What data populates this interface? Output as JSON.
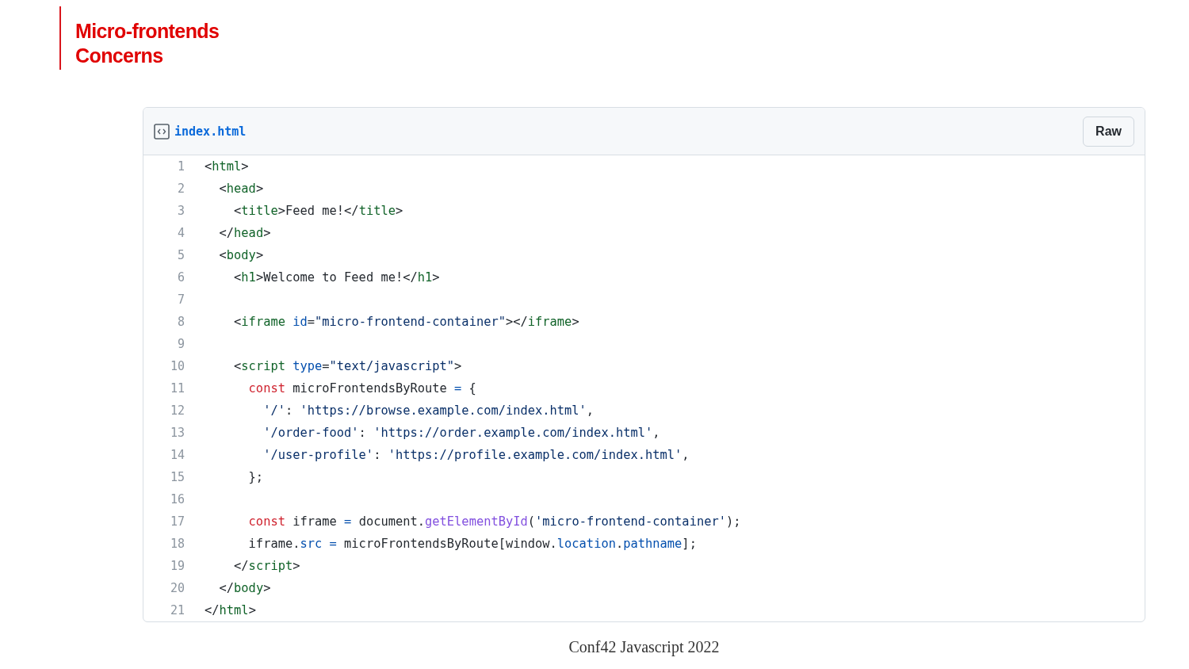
{
  "slide_title": [
    "Micro-frontends",
    "Concerns"
  ],
  "file": {
    "name": "index.html",
    "button": "Raw"
  },
  "lines": [
    {
      "number": "1",
      "tokens": [
        {
          "kind": "plain",
          "text": "<"
        },
        {
          "kind": "tag",
          "text": "html"
        },
        {
          "kind": "plain",
          "text": ">"
        }
      ]
    },
    {
      "number": "2",
      "tokens": [
        {
          "kind": "plain",
          "text": "  <"
        },
        {
          "kind": "tag",
          "text": "head"
        },
        {
          "kind": "plain",
          "text": ">"
        }
      ]
    },
    {
      "number": "3",
      "tokens": [
        {
          "kind": "plain",
          "text": "    <"
        },
        {
          "kind": "tag",
          "text": "title"
        },
        {
          "kind": "plain",
          "text": ">Feed me!</"
        },
        {
          "kind": "tag",
          "text": "title"
        },
        {
          "kind": "plain",
          "text": ">"
        }
      ]
    },
    {
      "number": "4",
      "tokens": [
        {
          "kind": "plain",
          "text": "  </"
        },
        {
          "kind": "tag",
          "text": "head"
        },
        {
          "kind": "plain",
          "text": ">"
        }
      ]
    },
    {
      "number": "5",
      "tokens": [
        {
          "kind": "plain",
          "text": "  <"
        },
        {
          "kind": "tag",
          "text": "body"
        },
        {
          "kind": "plain",
          "text": ">"
        }
      ]
    },
    {
      "number": "6",
      "tokens": [
        {
          "kind": "plain",
          "text": "    <"
        },
        {
          "kind": "tag",
          "text": "h1"
        },
        {
          "kind": "plain",
          "text": ">Welcome to Feed me!</"
        },
        {
          "kind": "tag",
          "text": "h1"
        },
        {
          "kind": "plain",
          "text": ">"
        }
      ]
    },
    {
      "number": "7"
    },
    {
      "number": "8",
      "tokens": [
        {
          "kind": "plain",
          "text": "    <"
        },
        {
          "kind": "tag",
          "text": "iframe"
        },
        {
          "kind": "attr",
          "text": " id"
        },
        {
          "kind": "plain",
          "text": "="
        },
        {
          "kind": "string",
          "text": "\"micro-frontend-container\""
        },
        {
          "kind": "plain",
          "text": "></"
        },
        {
          "kind": "tag",
          "text": "iframe"
        },
        {
          "kind": "plain",
          "text": ">"
        }
      ]
    },
    {
      "number": "9"
    },
    {
      "number": "10",
      "tokens": [
        {
          "kind": "plain",
          "text": "    <"
        },
        {
          "kind": "tag",
          "text": "script"
        },
        {
          "kind": "attr",
          "text": " type"
        },
        {
          "kind": "plain",
          "text": "="
        },
        {
          "kind": "string",
          "text": "\"text/javascript\""
        },
        {
          "kind": "plain",
          "text": ">"
        }
      ]
    },
    {
      "number": "11",
      "tokens": [
        {
          "kind": "keyword",
          "text": "      const"
        },
        {
          "kind": "plain",
          "text": " microFrontendsByRoute "
        },
        {
          "kind": "attr",
          "text": "="
        },
        {
          "kind": "plain",
          "text": " {"
        }
      ]
    },
    {
      "number": "12",
      "tokens": [
        {
          "kind": "string",
          "text": "        '/'"
        },
        {
          "kind": "plain",
          "text": ": "
        },
        {
          "kind": "string",
          "text": "'https://browse.example.com/index.html'"
        },
        {
          "kind": "plain",
          "text": ","
        }
      ]
    },
    {
      "number": "13",
      "tokens": [
        {
          "kind": "string",
          "text": "        '/order-food'"
        },
        {
          "kind": "plain",
          "text": ": "
        },
        {
          "kind": "string",
          "text": "'https://order.example.com/index.html'"
        },
        {
          "kind": "plain",
          "text": ","
        }
      ]
    },
    {
      "number": "14",
      "tokens": [
        {
          "kind": "string",
          "text": "        '/user-profile'"
        },
        {
          "kind": "plain",
          "text": ": "
        },
        {
          "kind": "string",
          "text": "'https://profile.example.com/index.html'"
        },
        {
          "kind": "plain",
          "text": ","
        }
      ]
    },
    {
      "number": "15",
      "tokens": [
        {
          "kind": "plain",
          "text": "      };"
        }
      ]
    },
    {
      "number": "16"
    },
    {
      "number": "17",
      "tokens": [
        {
          "kind": "keyword",
          "text": "      const"
        },
        {
          "kind": "plain",
          "text": " iframe "
        },
        {
          "kind": "attr",
          "text": "="
        },
        {
          "kind": "plain",
          "text": " document."
        },
        {
          "kind": "func",
          "text": "getElementById"
        },
        {
          "kind": "plain",
          "text": "("
        },
        {
          "kind": "string",
          "text": "'micro-frontend-container'"
        },
        {
          "kind": "plain",
          "text": ");"
        }
      ]
    },
    {
      "number": "18",
      "tokens": [
        {
          "kind": "plain",
          "text": "      iframe."
        },
        {
          "kind": "attr",
          "text": "src ="
        },
        {
          "kind": "plain",
          "text": " microFrontendsByRoute[window."
        },
        {
          "kind": "attr",
          "text": "location"
        },
        {
          "kind": "plain",
          "text": "."
        },
        {
          "kind": "attr",
          "text": "pathname"
        },
        {
          "kind": "plain",
          "text": "];"
        }
      ]
    },
    {
      "number": "19",
      "tokens": [
        {
          "kind": "plain",
          "text": "    </"
        },
        {
          "kind": "tag",
          "text": "script"
        },
        {
          "kind": "plain",
          "text": ">"
        }
      ]
    },
    {
      "number": "20",
      "tokens": [
        {
          "kind": "plain",
          "text": "  </"
        },
        {
          "kind": "tag",
          "text": "body"
        },
        {
          "kind": "plain",
          "text": ">"
        }
      ]
    },
    {
      "number": "21",
      "tokens": [
        {
          "kind": "plain",
          "text": "</"
        },
        {
          "kind": "tag",
          "text": "html"
        },
        {
          "kind": "plain",
          "text": ">"
        }
      ]
    }
  ],
  "footer": "Conf42 Javascript 2022"
}
